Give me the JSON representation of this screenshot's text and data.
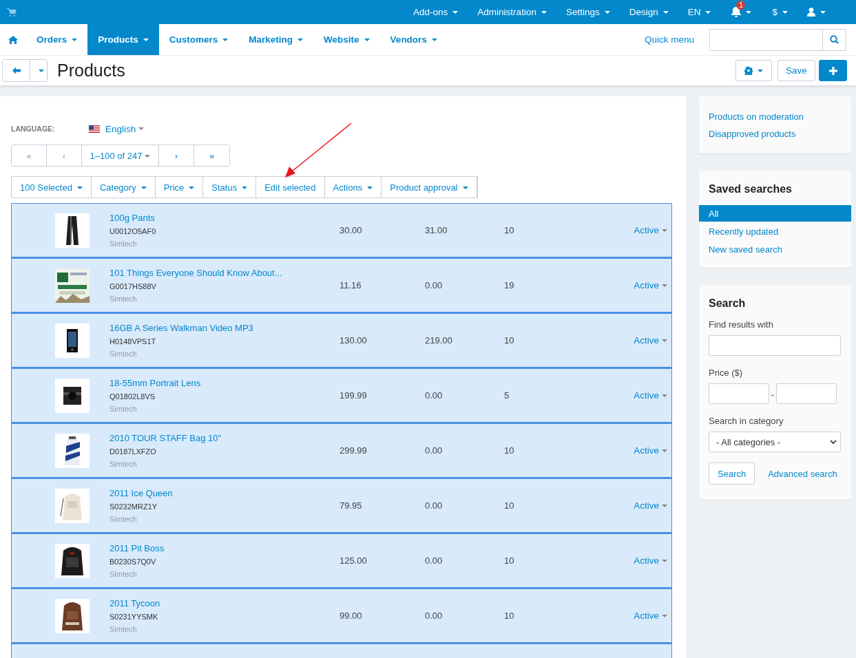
{
  "top_menu": [
    {
      "label": "Add-ons"
    },
    {
      "label": "Administration"
    },
    {
      "label": "Settings"
    },
    {
      "label": "Design"
    },
    {
      "label": "EN"
    }
  ],
  "notifications": {
    "badge": "1"
  },
  "currency": {
    "label": "$"
  },
  "nav": [
    {
      "label": "Orders",
      "selected": false
    },
    {
      "label": "Products",
      "selected": true
    },
    {
      "label": "Customers",
      "selected": false
    },
    {
      "label": "Marketing",
      "selected": false
    },
    {
      "label": "Website",
      "selected": false
    },
    {
      "label": "Vendors",
      "selected": false
    }
  ],
  "quick_menu": "Quick menu",
  "page_title": "Products",
  "save_button": "Save",
  "language": {
    "label": "LANGUAGE:",
    "value": "English"
  },
  "pagination": [
    {
      "label": "«",
      "kind": "button"
    },
    {
      "label": "‹",
      "kind": "button"
    },
    {
      "label": "1–100 of 247",
      "kind": "dropdown"
    },
    {
      "label": "›",
      "kind": "button"
    },
    {
      "label": "»",
      "kind": "button"
    }
  ],
  "bulk_actions": [
    {
      "label": "100 Selected",
      "kind": "dropdown"
    },
    {
      "label": "Category",
      "kind": "dropdown"
    },
    {
      "label": "Price",
      "kind": "dropdown"
    },
    {
      "label": "Status",
      "kind": "dropdown"
    },
    {
      "label": "Edit selected",
      "kind": "button"
    },
    {
      "label": "Actions",
      "kind": "dropdown"
    },
    {
      "label": "Product approval",
      "kind": "dropdown"
    }
  ],
  "products": [
    {
      "name": "100g Pants",
      "code": "U0012O5AF0",
      "vendor": "Simtech",
      "price": "30.00",
      "list_price": "31.00",
      "quantity": "10",
      "status": "Active",
      "selected": true
    },
    {
      "name": "101 Things Everyone Should Know About...",
      "code": "G0017HS88V",
      "vendor": "Simtech",
      "price": "11.16",
      "list_price": "0.00",
      "quantity": "19",
      "status": "Active",
      "selected": true
    },
    {
      "name": "16GB A Series Walkman Video MP3",
      "code": "H0148VPS1T",
      "vendor": "Simtech",
      "price": "130.00",
      "list_price": "219.00",
      "quantity": "10",
      "status": "Active",
      "selected": true
    },
    {
      "name": "18-55mm Portrait Lens",
      "code": "Q01802L8VS",
      "vendor": "Simtech",
      "price": "199.99",
      "list_price": "0.00",
      "quantity": "5",
      "status": "Active",
      "selected": true
    },
    {
      "name": "2010 TOUR STAFF Bag 10\"",
      "code": "D0187LXFZO",
      "vendor": "Simtech",
      "price": "299.99",
      "list_price": "0.00",
      "quantity": "10",
      "status": "Active",
      "selected": true
    },
    {
      "name": "2011 Ice Queen",
      "code": "S0232MRZ1Y",
      "vendor": "Simtech",
      "price": "79.95",
      "list_price": "0.00",
      "quantity": "10",
      "status": "Active",
      "selected": true
    },
    {
      "name": "2011 Pit Boss",
      "code": "B0230S7Q0V",
      "vendor": "Simtech",
      "price": "125.00",
      "list_price": "0.00",
      "quantity": "10",
      "status": "Active",
      "selected": true
    },
    {
      "name": "2011 Tycoon",
      "code": "S0231YYSMK",
      "vendor": "Simtech",
      "price": "99.00",
      "list_price": "0.00",
      "quantity": "10",
      "status": "Active",
      "selected": true
    }
  ],
  "moderation_links": [
    {
      "label": "Products on moderation"
    },
    {
      "label": "Disapproved products"
    }
  ],
  "saved_searches": {
    "title": "Saved searches",
    "items": [
      {
        "label": "All",
        "selected": true
      },
      {
        "label": "Recently updated",
        "selected": false
      },
      {
        "label": "New saved search",
        "selected": false
      }
    ]
  },
  "search": {
    "title": "Search",
    "find_label": "Find results with",
    "price_label": "Price ($)",
    "price_separator": "-",
    "category_label": "Search in category",
    "category_value": "- All categories -",
    "search_button": "Search",
    "advanced_link": "Advanced search"
  }
}
